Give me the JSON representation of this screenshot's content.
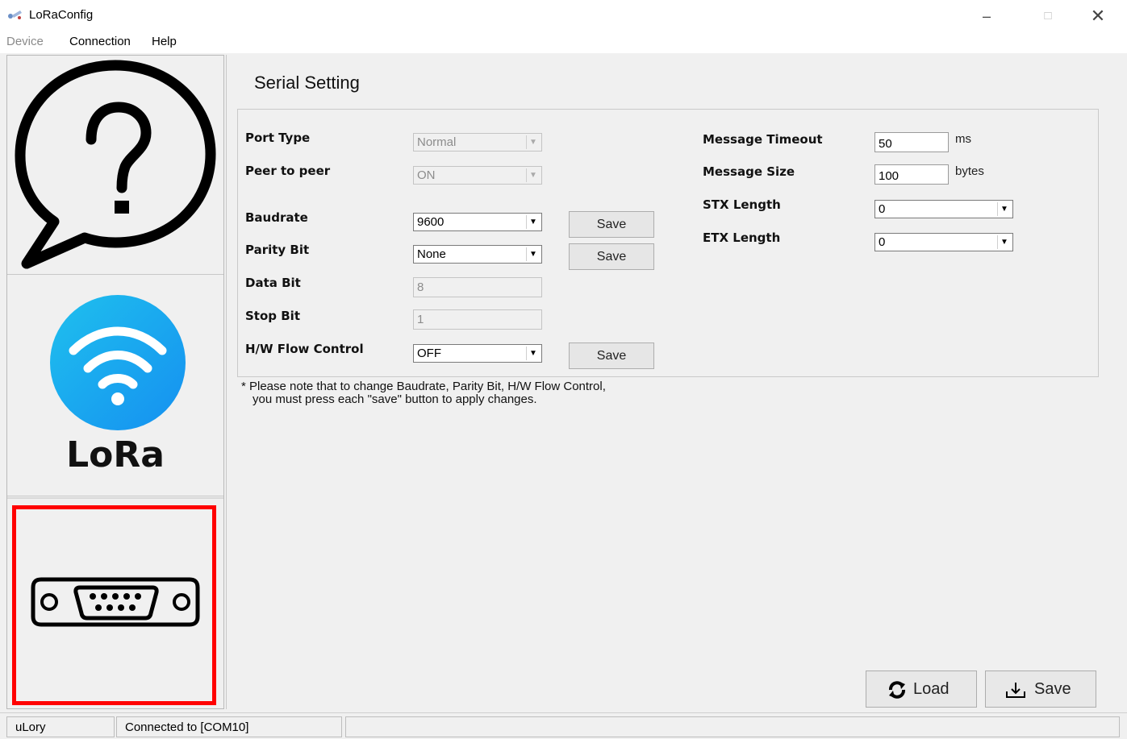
{
  "window": {
    "title": "LoRaConfig",
    "minimize": "–",
    "maximize": "□",
    "close": "✕"
  },
  "menu": {
    "device": "Device",
    "connection": "Connection",
    "help": "Help"
  },
  "sidebar": {
    "lora_label": "LoRa"
  },
  "main": {
    "title": "Serial Setting",
    "fields": {
      "port_type": {
        "label": "Port Type",
        "value": "Normal"
      },
      "peer_to_peer": {
        "label": "Peer to peer",
        "value": "ON"
      },
      "baudrate": {
        "label": "Baudrate",
        "value": "9600",
        "save": "Save"
      },
      "parity_bit": {
        "label": "Parity Bit",
        "value": "None",
        "save": "Save"
      },
      "data_bit": {
        "label": "Data Bit",
        "value": "8"
      },
      "stop_bit": {
        "label": "Stop Bit",
        "value": "1"
      },
      "hw_flow": {
        "label": "H/W Flow Control",
        "value": "OFF",
        "save": "Save"
      },
      "message_timeout": {
        "label": "Message Timeout",
        "value": "50",
        "unit": "ms"
      },
      "message_size": {
        "label": "Message Size",
        "value": "100",
        "unit": "bytes"
      },
      "stx_length": {
        "label": "STX Length",
        "value": "0"
      },
      "etx_length": {
        "label": "ETX Length",
        "value": "0"
      }
    },
    "note_line1": "* Please note that to change Baudrate, Parity Bit, H/W Flow Control,",
    "note_line2": "you must press each \"save\" button to apply changes.",
    "load_label": "Load",
    "save_label": "Save"
  },
  "status": {
    "app": "uLory",
    "connection": "Connected to [COM10]"
  },
  "colors": {
    "selection_frame": "#ff0000",
    "lora_circle": "#1aa7f0"
  },
  "icons": [
    "app-icon",
    "help-bubble-icon",
    "lora-wifi-icon",
    "serial-port-icon",
    "refresh-icon",
    "download-icon"
  ]
}
